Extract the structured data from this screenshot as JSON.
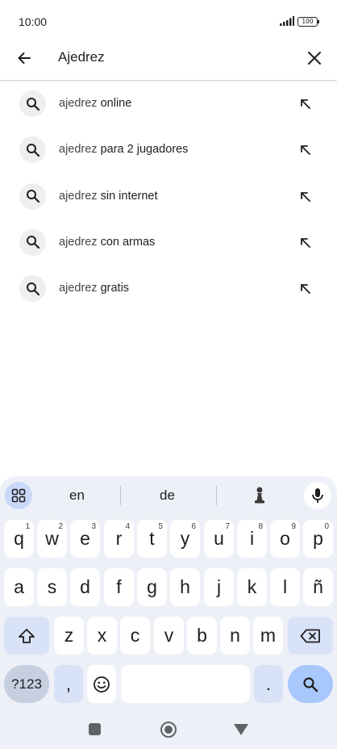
{
  "status_bar": {
    "time": "10:00",
    "battery": "100"
  },
  "search": {
    "query": "Ajedrez",
    "placeholder": ""
  },
  "suggestions": [
    {
      "base": "ajedrez",
      "rest": " online"
    },
    {
      "base": "ajedrez",
      "rest": " para 2 jugadores"
    },
    {
      "base": "ajedrez",
      "rest": " sin internet"
    },
    {
      "base": "ajedrez",
      "rest": " con armas"
    },
    {
      "base": "ajedrez",
      "rest": " gratis"
    }
  ],
  "keyboard": {
    "suggestion_words": [
      "en",
      "de"
    ],
    "row1": [
      {
        "key": "q",
        "hint": "1"
      },
      {
        "key": "w",
        "hint": "2"
      },
      {
        "key": "e",
        "hint": "3"
      },
      {
        "key": "r",
        "hint": "4"
      },
      {
        "key": "t",
        "hint": "5"
      },
      {
        "key": "y",
        "hint": "6"
      },
      {
        "key": "u",
        "hint": "7"
      },
      {
        "key": "i",
        "hint": "8"
      },
      {
        "key": "o",
        "hint": "9"
      },
      {
        "key": "p",
        "hint": "0"
      }
    ],
    "row2": [
      "a",
      "s",
      "d",
      "f",
      "g",
      "h",
      "j",
      "k",
      "l",
      "ñ"
    ],
    "row3": [
      "z",
      "x",
      "c",
      "v",
      "b",
      "n",
      "m"
    ],
    "symbols_label": "?123",
    "comma": ",",
    "period": "."
  },
  "colors": {
    "keyboard_bg": "#eef0f8",
    "accent_key": "#a8c7fa",
    "special_key": "#d9e3f7"
  }
}
